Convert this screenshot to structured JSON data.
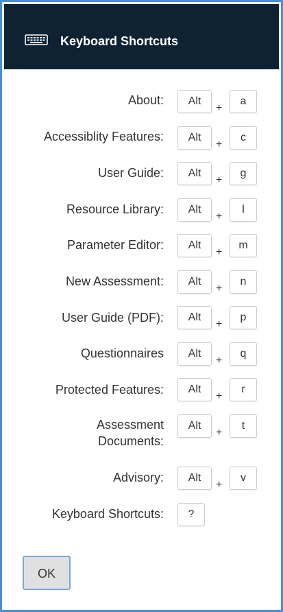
{
  "dialog": {
    "title": "Keyboard Shortcuts",
    "icon": "keyboard-icon",
    "ok_label": "OK"
  },
  "shortcuts": [
    {
      "label": "About:",
      "modifier": "Alt",
      "key": "a"
    },
    {
      "label": "Accessiblity Features:",
      "modifier": "Alt",
      "key": "c"
    },
    {
      "label": "User Guide:",
      "modifier": "Alt",
      "key": "g"
    },
    {
      "label": "Resource Library:",
      "modifier": "Alt",
      "key": "l"
    },
    {
      "label": "Parameter Editor:",
      "modifier": "Alt",
      "key": "m"
    },
    {
      "label": "New Assessment:",
      "modifier": "Alt",
      "key": "n"
    },
    {
      "label": "User Guide (PDF):",
      "modifier": "Alt",
      "key": "p"
    },
    {
      "label": "Questionnaires",
      "modifier": "Alt",
      "key": "q"
    },
    {
      "label": "Protected Features:",
      "modifier": "Alt",
      "key": "r"
    },
    {
      "label": "Assessment Documents:",
      "modifier": "Alt",
      "key": "t"
    },
    {
      "label": "Advisory:",
      "modifier": "Alt",
      "key": "v"
    },
    {
      "label": "Keyboard Shortcuts:",
      "modifier": "",
      "key": "?"
    }
  ],
  "plus_sign": "+"
}
